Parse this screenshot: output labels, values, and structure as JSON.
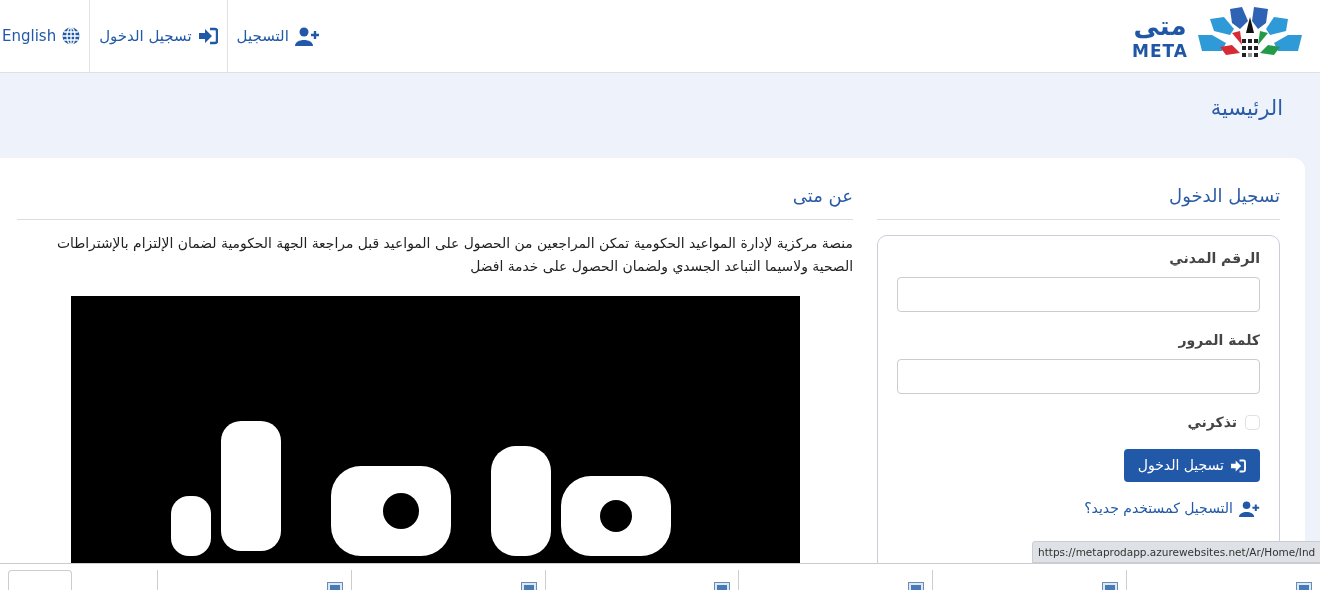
{
  "logo": {
    "arabic": "متى",
    "latin": "META"
  },
  "nav": [
    {
      "kind": "register",
      "label": "التسجيل"
    },
    {
      "kind": "login",
      "label": "تسجيل الدخول"
    },
    {
      "kind": "language",
      "label": "English"
    }
  ],
  "breadcrumb": "الرئيسية",
  "login": {
    "title": "تسجيل الدخول",
    "fields": [
      {
        "label": "الرقم المدني"
      },
      {
        "label": "كلمة المرور"
      }
    ],
    "remember": {
      "label": "تذكرني",
      "checked": false
    },
    "submit": "تسجيل الدخول",
    "register_link": "التسجيل كمستخدم جديد؟"
  },
  "about": {
    "title": "عن متى",
    "text": "منصة مركزية لإدارة المواعيد الحكومية تمكن المراجعين من الحصول على المواعيد قبل مراجعة الجهة الحكومية لضمان الإلتزام بالإشتراطات الصحية ولاسيما التباعد الجسدي ولضمان الحصول على خدمة افضل"
  },
  "status_url": "https://metaprodapp.azurewebsites.net/Ar/Home/Ind",
  "downloads": [
    {
      "kind": "file"
    },
    {
      "kind": "file"
    },
    {
      "kind": "file"
    },
    {
      "kind": "file"
    },
    {
      "kind": "file"
    },
    {
      "kind": "file"
    }
  ]
}
